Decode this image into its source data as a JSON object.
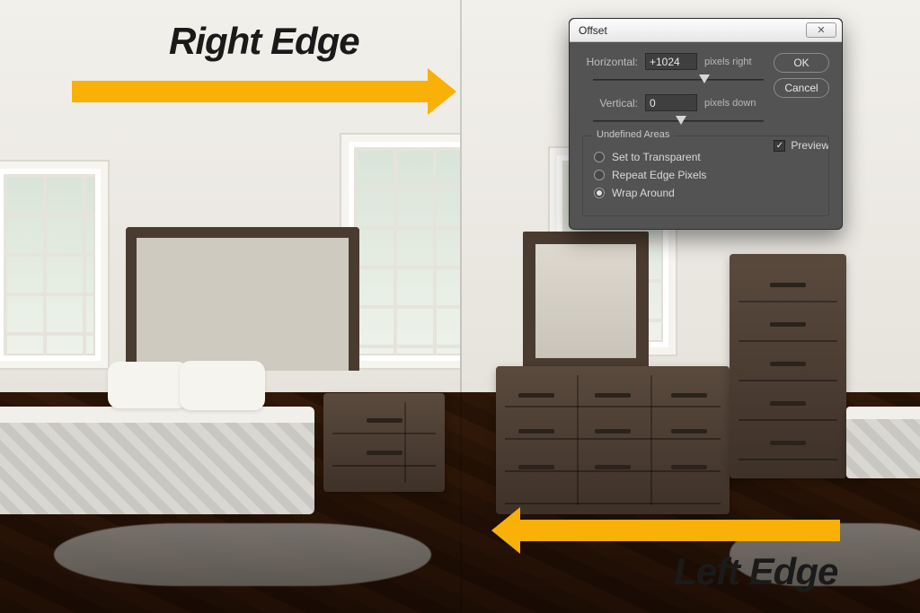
{
  "annotations": {
    "right_label": "Right Edge",
    "left_label": "Left Edge"
  },
  "dialog": {
    "title": "Offset",
    "close_glyph": "✕",
    "horizontal_label": "Horizontal:",
    "horizontal_value": "+1024",
    "horizontal_unit": "pixels right",
    "vertical_label": "Vertical:",
    "vertical_value": "0",
    "vertical_unit": "pixels down",
    "ok_label": "OK",
    "cancel_label": "Cancel",
    "preview_label": "Preview",
    "preview_checked": true,
    "group_title": "Undefined Areas",
    "radio_transparent": "Set to Transparent",
    "radio_repeat": "Repeat Edge Pixels",
    "radio_wrap": "Wrap Around",
    "selected_radio": "wrap"
  }
}
